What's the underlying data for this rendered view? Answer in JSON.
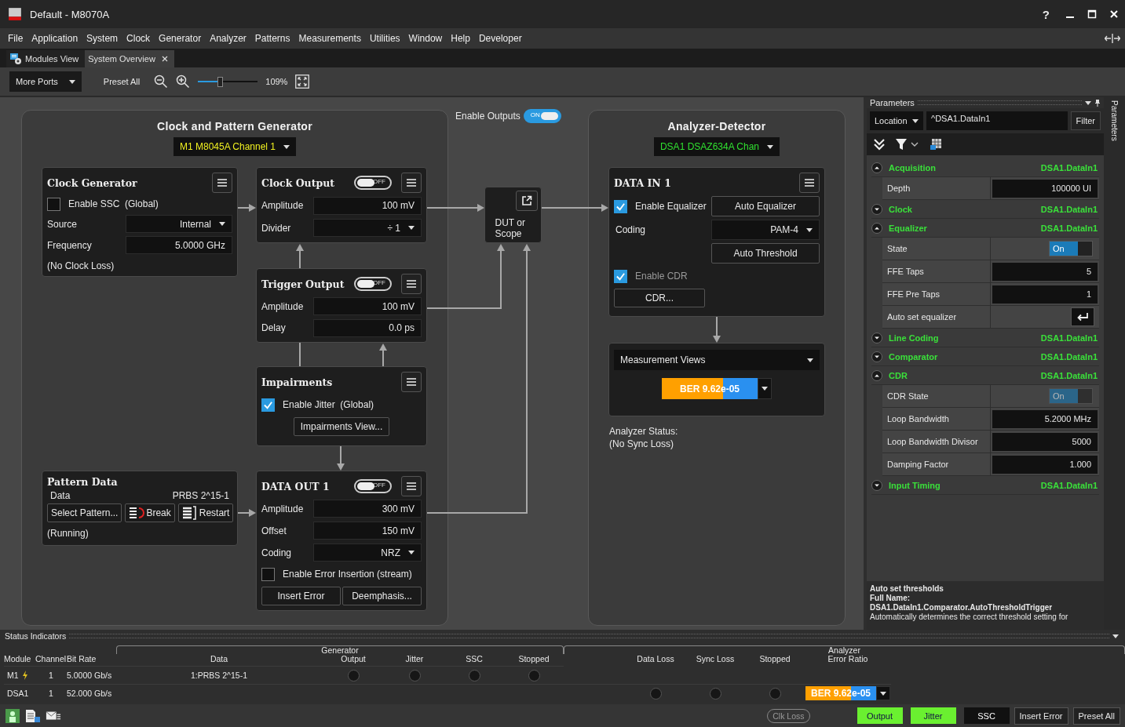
{
  "window": {
    "title": "Default - M8070A",
    "help": "?"
  },
  "menu": [
    "File",
    "Application",
    "System",
    "Clock",
    "Generator",
    "Analyzer",
    "Patterns",
    "Measurements",
    "Utilities",
    "Window",
    "Help",
    "Developer"
  ],
  "tabs": [
    {
      "label": "Modules View",
      "selected": false,
      "closable": false
    },
    {
      "label": "System Overview",
      "selected": true,
      "closable": true
    }
  ],
  "toolbar": {
    "ports": "More Ports",
    "preset": "Preset All",
    "zoom": {
      "level": 0.37,
      "reading": "109%"
    }
  },
  "generator": {
    "title": "Clock and Pattern Generator",
    "channel": "M1 M8045A Channel 1",
    "clock_generator": {
      "title": "Clock Generator",
      "ssc": {
        "label": "Enable SSC  (Global)",
        "checked": false
      },
      "fields": [
        {
          "label": "Source",
          "value": "Internal",
          "kind": "dropdown"
        },
        {
          "label": "Frequency",
          "value": "5.0000 GHz",
          "kind": "number"
        }
      ],
      "status": "(No Clock Loss)"
    },
    "clock_output": {
      "title": "Clock Output",
      "on": false,
      "toggle": "OFF",
      "fields": [
        {
          "label": "Amplitude",
          "value": "100 mV",
          "kind": "number"
        },
        {
          "label": "Divider",
          "value": "÷ 1",
          "kind": "dropdown"
        }
      ]
    },
    "trigger_output": {
      "title": "Trigger Output",
      "on": false,
      "toggle": "OFF",
      "fields": [
        {
          "label": "Amplitude",
          "value": "100 mV",
          "kind": "number"
        },
        {
          "label": "Delay",
          "value": "0.0 ps",
          "kind": "number"
        }
      ]
    },
    "impairments": {
      "title": "Impairments",
      "jitter": {
        "label": "Enable Jitter  (Global)",
        "checked": true
      },
      "button": "Impairments View..."
    },
    "pattern_data": {
      "title": "Pattern Data",
      "data_label": "Data",
      "data_value": "PRBS 2^15-1",
      "buttons": [
        {
          "label": "Select Pattern...",
          "kind": "plain"
        },
        {
          "label": "Break",
          "kind": "break"
        },
        {
          "label": "Restart",
          "kind": "restart"
        }
      ],
      "status": "(Running)"
    },
    "data_out": {
      "title": "DATA OUT 1",
      "on": false,
      "toggle": "OFF",
      "fields": [
        {
          "label": "Amplitude",
          "value": "300 mV",
          "kind": "number"
        },
        {
          "label": "Offset",
          "value": "150 mV",
          "kind": "number"
        },
        {
          "label": "Coding",
          "value": "NRZ",
          "kind": "dropdown"
        }
      ],
      "error_insertion": {
        "label": "Enable Error Insertion (stream)",
        "checked": false
      },
      "buttons": [
        "Insert Error",
        "Deemphasis..."
      ]
    }
  },
  "enable_outputs": {
    "label": "Enable Outputs",
    "on": true,
    "toggle": "ON"
  },
  "dut": {
    "label": "DUT or Scope"
  },
  "analyzer": {
    "title": "Analyzer-Detector",
    "channel": "DSA1 DSAZ634A Chan",
    "data_in": {
      "title": "DATA IN 1",
      "equalizer": {
        "label": "Enable Equalizer",
        "checked": true
      },
      "auto_equalizer": "Auto Equalizer",
      "coding_label": "Coding",
      "coding": "PAM-4",
      "auto_threshold": "Auto Threshold",
      "cdr": {
        "label": "Enable CDR",
        "checked": true,
        "disabled": true
      },
      "cdr_button": "CDR..."
    },
    "measurement_views": "Measurement Views",
    "ber": {
      "text": "BER 9.62e-05",
      "level": 0.64
    },
    "status": [
      "Analyzer Status:",
      "(No Sync Loss)"
    ]
  },
  "parameters": {
    "title": "Parameters",
    "location": "Location",
    "path": "^DSA1.DataIn1",
    "filter": "Filter",
    "side_tab": "Parameters",
    "groups": [
      {
        "name": "Acquisition",
        "path": "DSA1.DataIn1",
        "expanded": true,
        "rows": [
          {
            "label": "Depth",
            "kind": "value",
            "value": "100000 UI"
          }
        ]
      },
      {
        "name": "Clock",
        "path": "DSA1.DataIn1",
        "expanded": false
      },
      {
        "name": "Equalizer",
        "path": "DSA1.DataIn1",
        "expanded": true,
        "rows": [
          {
            "label": "State",
            "kind": "switch",
            "value": "On",
            "on": true,
            "disabled": false
          },
          {
            "label": "FFE Taps",
            "kind": "value",
            "value": "5"
          },
          {
            "label": "FFE Pre Taps",
            "kind": "value",
            "value": "1"
          },
          {
            "label": "Auto set equalizer",
            "kind": "action"
          }
        ]
      },
      {
        "name": "Line Coding",
        "path": "DSA1.DataIn1",
        "expanded": false
      },
      {
        "name": "Comparator",
        "path": "DSA1.DataIn1",
        "expanded": false
      },
      {
        "name": "CDR",
        "path": "DSA1.DataIn1",
        "expanded": true,
        "rows": [
          {
            "label": "CDR State",
            "kind": "switch",
            "value": "On",
            "on": true,
            "disabled": true
          },
          {
            "label": "Loop Bandwidth",
            "kind": "value",
            "value": "5.2000 MHz"
          },
          {
            "label": "Loop Bandwidth Divisor",
            "kind": "value",
            "value": "5000"
          },
          {
            "label": "Damping Factor",
            "kind": "value",
            "value": "1.000"
          }
        ]
      },
      {
        "name": "Input Timing",
        "path": "DSA1.DataIn1",
        "expanded": false
      }
    ],
    "help": {
      "title": "Auto set thresholds",
      "full_name_label": "Full Name:",
      "full_name": "DSA1.DataIn1.Comparator.AutoThresholdTrigger",
      "description": "Automatically determines the correct threshold setting for"
    }
  },
  "status_indicators": {
    "title": "Status Indicators",
    "columns": [
      "Module",
      "Channel",
      "Bit Rate"
    ],
    "generator_label": "Generator",
    "generator_columns": [
      "Data",
      "Output",
      "Jitter",
      "SSC",
      "Stopped"
    ],
    "analyzer_label": "Analyzer",
    "analyzer_columns": [
      "Data Loss",
      "Sync Loss",
      "Stopped",
      "Error Ratio"
    ],
    "rows": [
      {
        "module": "M1",
        "kind": "generator",
        "channel": "1",
        "bit_rate": "5.0000 Gb/s",
        "data": "1:PRBS 2^15-1"
      },
      {
        "module": "DSA1",
        "kind": "analyzer",
        "channel": "1",
        "bit_rate": "52.000 Gb/s",
        "ber": {
          "text": "BER 9.62e-05",
          "level": 0.64
        }
      }
    ]
  },
  "bottom_bar": {
    "indicators": [
      {
        "label": "Clk Loss",
        "kind": "pill",
        "on": false
      },
      {
        "label": "Output",
        "kind": "box",
        "on": true
      },
      {
        "label": "Jitter",
        "kind": "box",
        "on": true
      },
      {
        "label": "SSC",
        "kind": "box",
        "on": false
      }
    ],
    "buttons": [
      "Insert Error",
      "Preset All"
    ]
  }
}
